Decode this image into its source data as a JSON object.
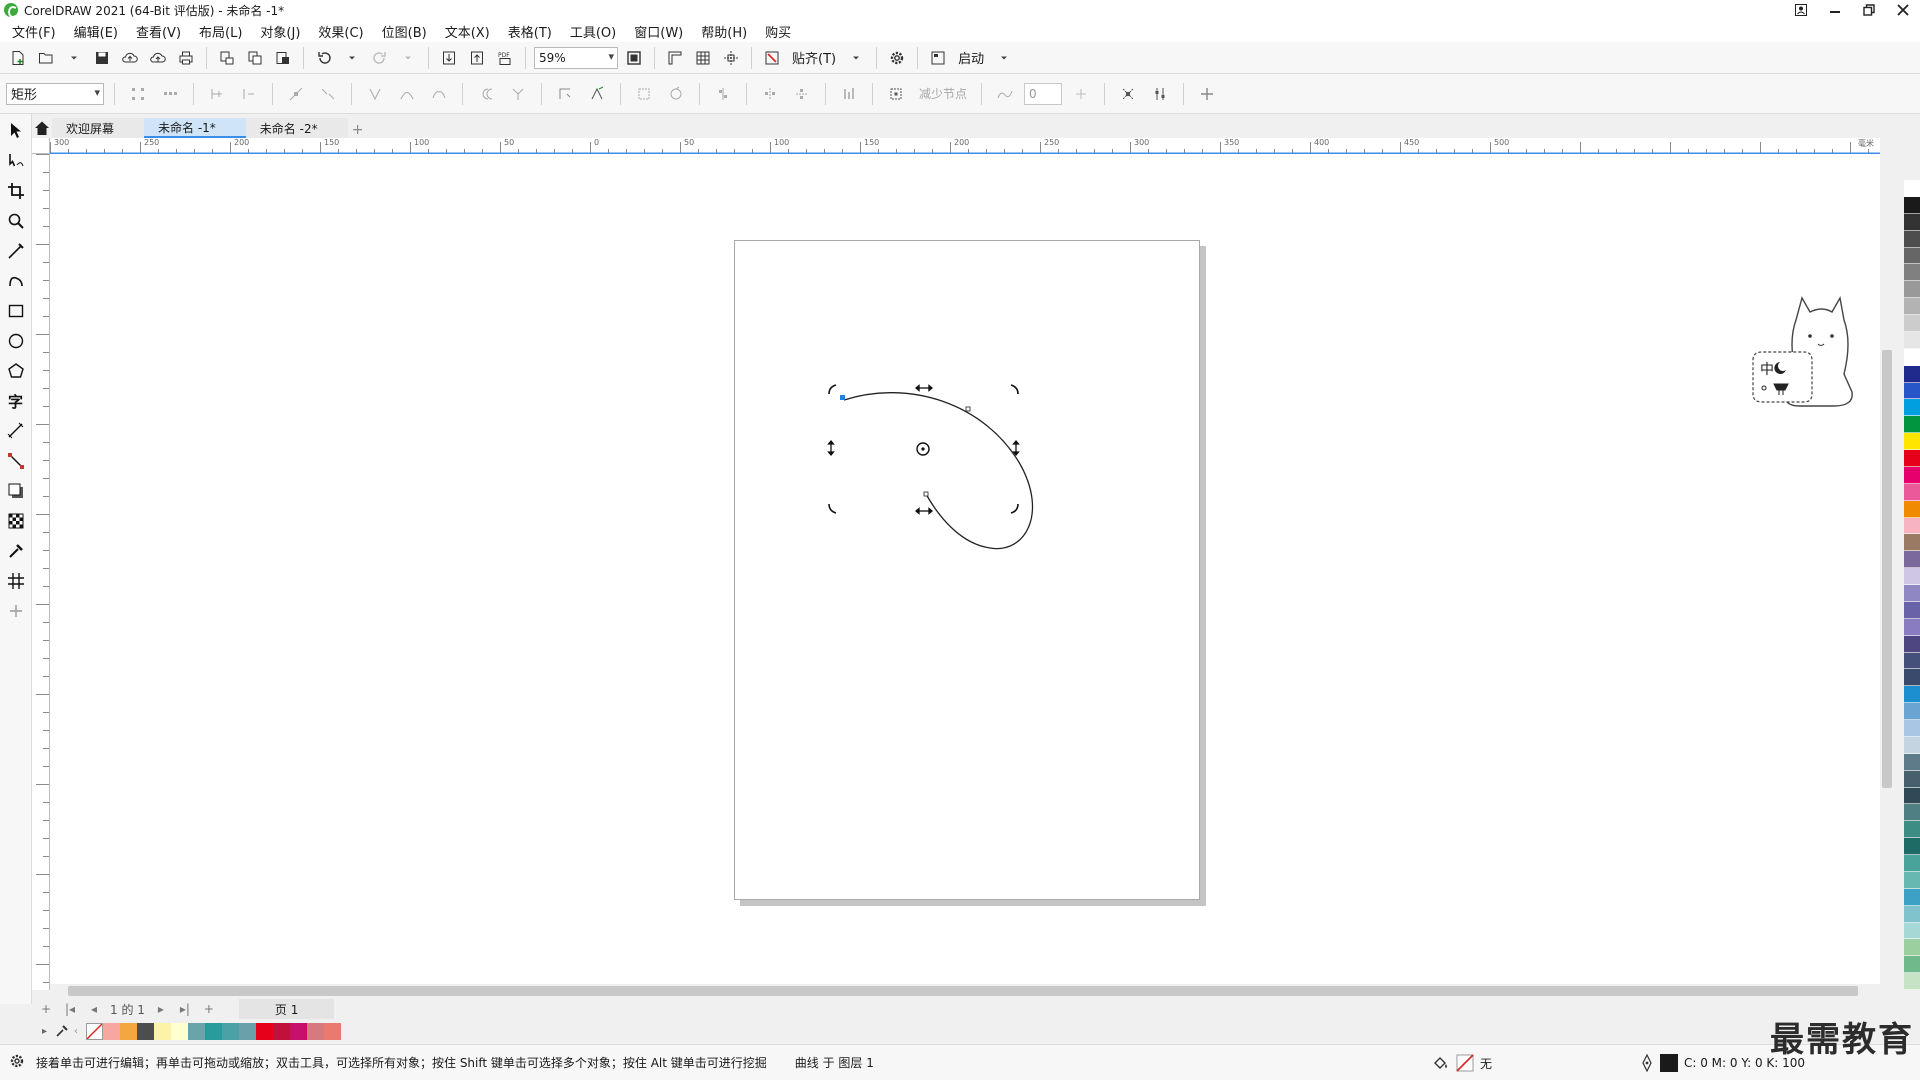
{
  "window": {
    "title": "CorelDRAW 2021 (64-Bit 评估版) - 未命名 -1*"
  },
  "menu": [
    "文件(F)",
    "编辑(E)",
    "查看(V)",
    "布局(L)",
    "对象(J)",
    "效果(C)",
    "位图(B)",
    "文本(X)",
    "表格(T)",
    "工具(O)",
    "窗口(W)",
    "帮助(H)",
    "购买"
  ],
  "toolbar": {
    "zoom": "59%",
    "snap_label": "贴齐(T)",
    "launch_label": "启动"
  },
  "propbar": {
    "shape_select": "矩形",
    "reduce_nodes": "减少节点",
    "smooth_value": "0"
  },
  "tabs": [
    "欢迎屏幕",
    "未命名 -1*",
    "未命名 -2*"
  ],
  "ruler_ticks": [
    "300",
    "250",
    "200",
    "150",
    "100",
    "50",
    "0",
    "50",
    "100",
    "150",
    "200",
    "250",
    "300",
    "350",
    "400",
    "450",
    "500"
  ],
  "ruler_unit": "毫米",
  "pagebar": {
    "page_info": "1 的 1",
    "page_tab": "页 1"
  },
  "status": {
    "hint": "接着单击可进行编辑；再单击可拖动或缩放；双击工具，可选择所有对象；按住 Shift 键单击可选择多个对象；按住 Alt 键单击可进行挖掘",
    "object": "曲线 于 图层 1",
    "fill": "无",
    "outline_values": "C: 0 M: 0 Y: 0 K: 100"
  },
  "mascot_label": "中",
  "watermark": "最需教育",
  "colors": {
    "accent": "#3b8ee8",
    "palette": [
      "#ffffff",
      "#1a1a1a",
      "#333333",
      "#4d4d4d",
      "#666666",
      "#808080",
      "#999999",
      "#b3b3b3",
      "#cccccc",
      "#e6e6e6",
      "#ffffff",
      "#1e2a8c",
      "#2756c8",
      "#00a0e0",
      "#00963f",
      "#ffe600",
      "#e6001a",
      "#e5006e",
      "#ea5a9a",
      "#f08a00",
      "#f7b3c0",
      "#9a7a63",
      "#7a6a9c",
      "#cfc6e4",
      "#8e87c4",
      "#6a62a8",
      "#8a7cc0",
      "#4e4680",
      "#45507a",
      "#3a4a6c",
      "#1c8fd0",
      "#6aa4d2",
      "#a9c7e4",
      "#c4d4e0",
      "#5e7b8a",
      "#47606e",
      "#2f4a56",
      "#4f7f83",
      "#3c8e85",
      "#1e6a65",
      "#4aa39a",
      "#66b8b0",
      "#3ca1c4",
      "#80c3cc",
      "#a6d8d5",
      "#9bcf9f",
      "#6fb98a",
      "#c6e3c5"
    ],
    "doc_palette": [
      "#f7a7a0",
      "#f4a640",
      "#4d4d4d",
      "#fcf3a8",
      "#ffffd0",
      "#6aa4a8",
      "#2a9b9d",
      "#4ba1a6",
      "#6aa0aa",
      "#e6001a",
      "#c0103c",
      "#c7106d",
      "#d67a7f",
      "#ea7a70"
    ]
  }
}
